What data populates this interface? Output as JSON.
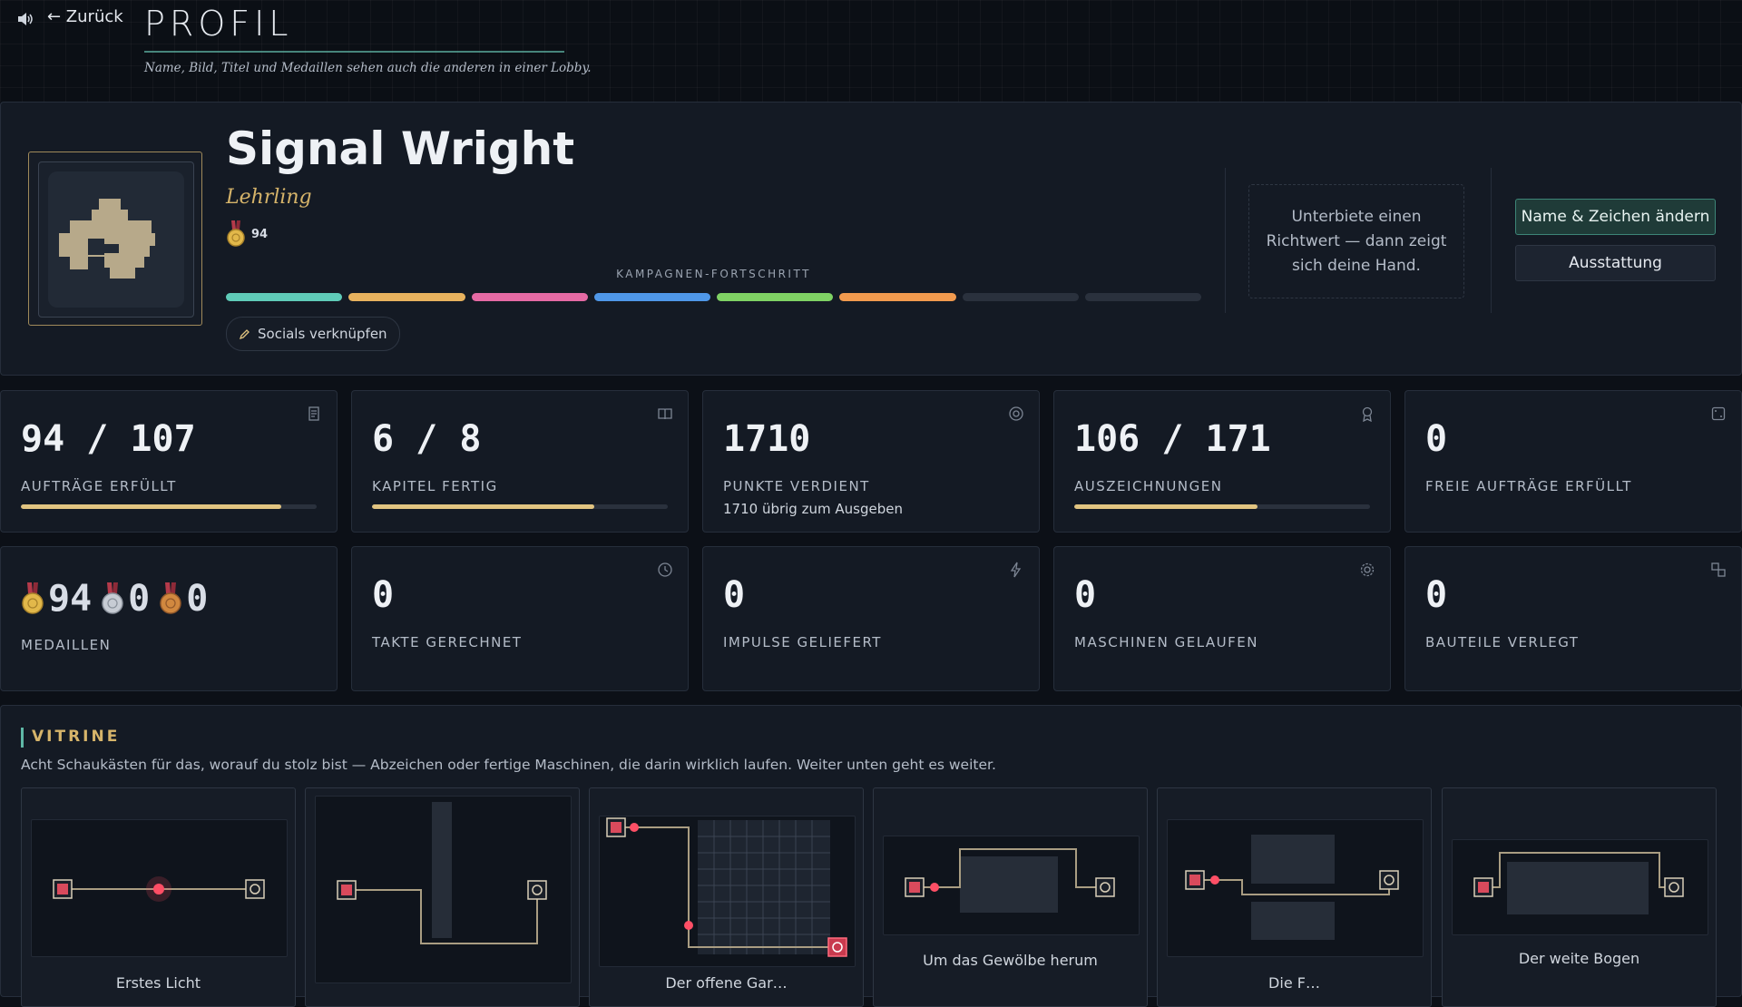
{
  "header": {
    "back_label": "← Zurück",
    "title": "PROFIL",
    "subtitle": "Name, Bild, Titel und Medaillen sehen auch die anderen in einer Lobby."
  },
  "profile": {
    "name": "Signal Wright",
    "rank": "Lehrling",
    "gold_medals": "94",
    "campaign_label": "KAMPAGNEN-FORTSCHRITT",
    "campaign_segments": [
      {
        "color": "#5fcbb8",
        "done": true
      },
      {
        "color": "#e7b25e",
        "done": true
      },
      {
        "color": "#e56aa4",
        "done": true
      },
      {
        "color": "#4f97e8",
        "done": true
      },
      {
        "color": "#7fd264",
        "done": true
      },
      {
        "color": "#f19a4e",
        "done": true
      },
      {
        "color": "#2a313d",
        "done": false
      },
      {
        "color": "#2a313d",
        "done": false
      }
    ],
    "socials_label": "Socials verknüpfen",
    "hint": "Unterbiete einen Richtwert — dann zeigt sich deine Hand.",
    "edit_button": "Name & Zeichen ändern",
    "outfit_button": "Ausstattung"
  },
  "stats": [
    {
      "value": "94 / 107",
      "label": "AUFTRÄGE ERFÜLLT",
      "progress": 0.88,
      "icon": "document-icon"
    },
    {
      "value": "6 / 8",
      "label": "KAPITEL FERTIG",
      "progress": 0.75,
      "icon": "book-icon"
    },
    {
      "value": "1710",
      "label": "PUNKTE VERDIENT",
      "note": "1710 übrig zum Ausgeben",
      "icon": "target-icon"
    },
    {
      "value": "106 / 171",
      "label": "AUSZEICHNUNGEN",
      "progress": 0.62,
      "icon": "ribbon-icon"
    },
    {
      "value": "0",
      "label": "FREIE AUFTRÄGE ERFÜLLT",
      "icon": "dice-icon"
    }
  ],
  "medals": {
    "gold": "94",
    "silver": "0",
    "bronze": "0",
    "label": "MEDAILLEN"
  },
  "stats2": [
    {
      "value": "0",
      "label": "TAKTE GERECHNET",
      "icon": "clock-icon"
    },
    {
      "value": "0",
      "label": "IMPULSE GELIEFERT",
      "icon": "bolt-icon"
    },
    {
      "value": "0",
      "label": "MASCHINEN GELAUFEN",
      "icon": "gear-icon"
    },
    {
      "value": "0",
      "label": "BAUTEILE VERLEGT",
      "icon": "parts-icon"
    }
  ],
  "vitrine": {
    "title": "VITRINE",
    "subtitle": "Acht Schaukästen für das, worauf du stolz bist — Abzeichen oder fertige Maschinen, die darin wirklich laufen. Weiter unten geht es weiter.",
    "cases": [
      {
        "caption": "Erstes Licht"
      },
      {
        "caption": ""
      },
      {
        "caption": "Der offene Gar…"
      },
      {
        "caption": "Um das Gewölbe herum"
      },
      {
        "caption": "Die F…"
      },
      {
        "caption": "Der weite Bogen"
      }
    ]
  },
  "colors": {
    "accent_teal": "#5fb8a6",
    "accent_gold": "#d6b46a",
    "bar_fill": "#e1c481"
  }
}
